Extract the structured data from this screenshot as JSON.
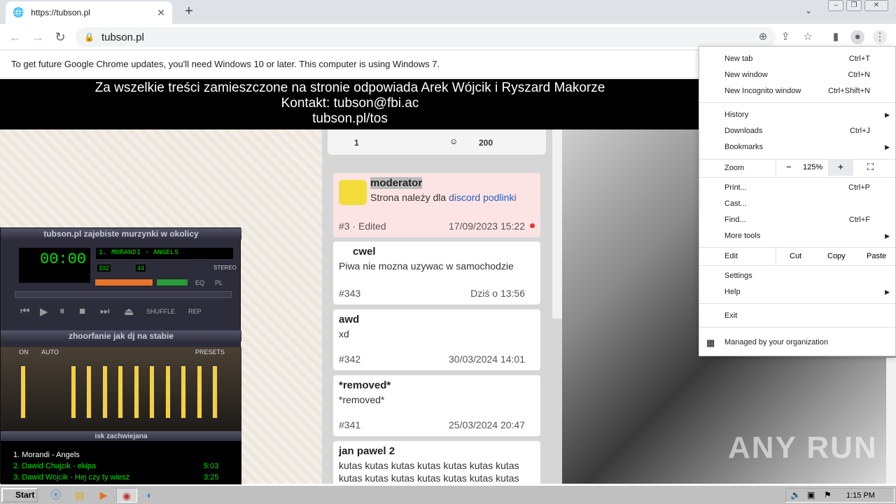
{
  "browser": {
    "tab_title": "https://tubson.pl",
    "url": "tubson.pl",
    "infobar_text": "To get future Google Chrome updates, you'll need Windows 10 or later. This computer is using Windows 7."
  },
  "banner": {
    "line1": "Za wszelkie treści zamieszczone na stronie odpowiada Arek Wójcik i Ryszard Makorze",
    "line2": "Kontakt: tubson@fbi.ac",
    "line3": "tubson.pl/tos"
  },
  "top_card": {
    "left_count": "1",
    "right_count": "200"
  },
  "posts": [
    {
      "author": "moderator",
      "text_before": "Strona należy dla ",
      "link": "discord podlinki",
      "index": "#3 · Edited",
      "date": "17/09/2023 15:22"
    },
    {
      "author": "cwel",
      "text": "Piwa nie mozna uzywac w samochodzie",
      "index": "#343",
      "date": "Dziś o 13:56"
    },
    {
      "author": "awd",
      "text": "xd",
      "index": "#342",
      "date": "30/03/2024 14:01"
    },
    {
      "author": "*removed*",
      "text": "*removed*",
      "index": "#341",
      "date": "25/03/2024 20:47"
    },
    {
      "author": "jan pawel 2",
      "text": "kutas kutas kutas kutas kutas kutas kutas kutas kutas kutas kutas kutas kutas kutas"
    }
  ],
  "winamp": {
    "title": "tubson.pl zajebiste murzynki w okolicy",
    "time": "00:00",
    "song": "1. MORANDI - ANGELS",
    "kbps": "192",
    "khz": "44",
    "stereo": "STEREO",
    "eq_label": "EQ",
    "pl_label": "PL",
    "shuffle": "SHUFFLE",
    "rep": "REP",
    "eq_title": "zhoorfanie jak dj na stabie",
    "eq_on": "ON",
    "eq_auto": "AUTO",
    "eq_presets": "PRESETS",
    "playlist_title": "isk zachwiejana",
    "playlist": [
      {
        "name": "1. Morandi - Angels",
        "time": ""
      },
      {
        "name": "2. Dawid Chujcik - ekipa",
        "time": "5:03"
      },
      {
        "name": "3. Dawid Wojcik - Hej czy ty wiesz",
        "time": "3:25"
      }
    ]
  },
  "menu": {
    "new_tab": "New tab",
    "new_tab_sc": "Ctrl+T",
    "new_window": "New window",
    "new_window_sc": "Ctrl+N",
    "incognito": "New Incognito window",
    "incognito_sc": "Ctrl+Shift+N",
    "history": "History",
    "downloads": "Downloads",
    "downloads_sc": "Ctrl+J",
    "bookmarks": "Bookmarks",
    "zoom": "Zoom",
    "zoom_minus": "−",
    "zoom_value": "125%",
    "zoom_plus": "+",
    "print": "Print...",
    "print_sc": "Ctrl+P",
    "cast": "Cast...",
    "find": "Find...",
    "find_sc": "Ctrl+F",
    "more_tools": "More tools",
    "edit": "Edit",
    "cut": "Cut",
    "copy": "Copy",
    "paste": "Paste",
    "settings": "Settings",
    "help": "Help",
    "exit": "Exit",
    "managed": "Managed by your organization"
  },
  "watermark": "ANY RUN",
  "taskbar": {
    "start": "Start",
    "clock": "1:15 PM"
  }
}
